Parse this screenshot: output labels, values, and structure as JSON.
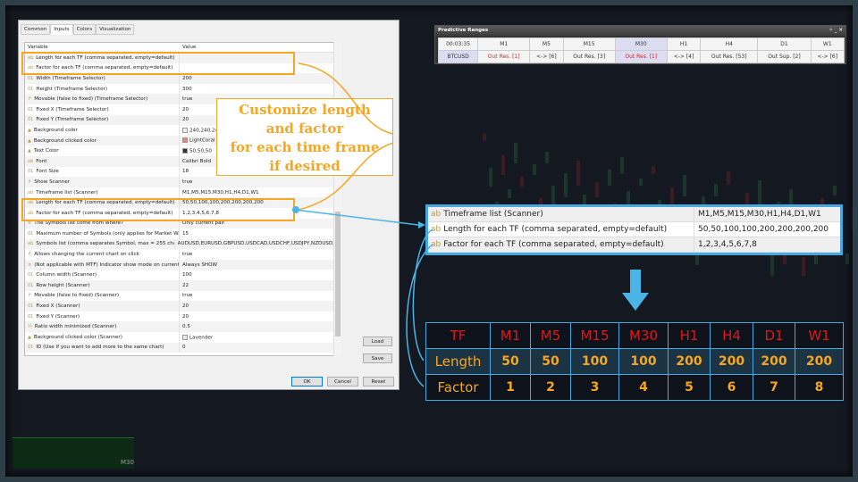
{
  "dialog": {
    "tabs": [
      "Common",
      "Inputs",
      "Colors",
      "Visualization"
    ],
    "active_tab": "Inputs",
    "columns": [
      "Variable",
      "Value"
    ],
    "rows": [
      {
        "icon": "ab",
        "name": "Length for each TF (comma separated, empty=default)",
        "value": ""
      },
      {
        "icon": "ab",
        "name": "Factor for each TF (comma separated, empty=default)",
        "value": ""
      },
      {
        "icon": "01",
        "name": "Width (Timeframe Selector)",
        "value": "200"
      },
      {
        "icon": "01",
        "name": "Height (Timeframe Selector)",
        "value": "300"
      },
      {
        "icon": "bool",
        "name": "Movable (false to fixed) (Timeframe Selector)",
        "value": "true"
      },
      {
        "icon": "01",
        "name": "Fixed X (Timeframe Selector)",
        "value": "20"
      },
      {
        "icon": "01",
        "name": "Fixed Y (Timeframe Selector)",
        "value": "20"
      },
      {
        "icon": "color",
        "name": "Background color",
        "value": "240,240,240",
        "swatch": "#f0f0f0"
      },
      {
        "icon": "color",
        "name": "Background clicked color",
        "value": "LightCoral",
        "swatch": "#f08080"
      },
      {
        "icon": "color",
        "name": "Text Color",
        "value": "50,50,50",
        "swatch": "#323232"
      },
      {
        "icon": "ab",
        "name": "Font",
        "value": "Calibri Bold"
      },
      {
        "icon": "01",
        "name": "Font Size",
        "value": "18"
      },
      {
        "icon": "bool",
        "name": "Show Scanner",
        "value": "true"
      },
      {
        "icon": "ab",
        "name": "Timeframe list (Scanner)",
        "value": "M1,M5,M15,M30,H1,H4,D1,W1"
      },
      {
        "icon": "ab",
        "name": "Length for each TF (comma separated, empty=default)",
        "value": "50,50,100,100,200,200,200,200"
      },
      {
        "icon": "ab",
        "name": "Factor for each TF (comma separated, empty=default)",
        "value": "1,2,3,4,5,6,7,8"
      },
      {
        "icon": "enum",
        "name": "The Symbols list come from where?",
        "value": "Only current pair"
      },
      {
        "icon": "01",
        "name": "Maximum number of Symbols (only applies for Market Watch)",
        "value": "15"
      },
      {
        "icon": "ab",
        "name": "Symbols list (comma separates Symbol, max = 255 characters)",
        "value": "AUDUSD,EURUSD,GBPUSD,USDCAD,USDCHF,USDJPY,NZDUSD,XA..."
      },
      {
        "icon": "bool",
        "name": "Allows changing the current chart on click",
        "value": "true"
      },
      {
        "icon": "enum",
        "name": "(Not applicable with MTF) Indicator show mode on current chart",
        "value": "Always SHOW"
      },
      {
        "icon": "01",
        "name": "Column width (Scanner)",
        "value": "100"
      },
      {
        "icon": "01",
        "name": "Row height (Scanner)",
        "value": "22"
      },
      {
        "icon": "bool",
        "name": "Movable (false to fixed) (Scanner)",
        "value": "true"
      },
      {
        "icon": "01",
        "name": "Fixed X (Scanner)",
        "value": "20"
      },
      {
        "icon": "01",
        "name": "Fixed Y (Scanner)",
        "value": "20"
      },
      {
        "icon": "frac",
        "name": "Ratio width minimized (Scanner)",
        "value": "0.5"
      },
      {
        "icon": "color",
        "name": "Background clicked color (Scanner)",
        "value": "Lavender",
        "swatch": "#e6e6fa"
      },
      {
        "icon": "01",
        "name": "ID (Use if you want to add more to the same chart)",
        "value": "0"
      }
    ],
    "buttons": {
      "load": "Load",
      "save": "Save",
      "ok": "OK",
      "cancel": "Cancel",
      "reset": "Reset"
    }
  },
  "callout": {
    "lines": [
      "Customize length",
      "and factor",
      "for each time frame",
      "if desired"
    ]
  },
  "predictive_ranges": {
    "title": "Predictive Ranges",
    "time": "00:03:35",
    "symbol": "BTCUSD",
    "timeframes": [
      "M1",
      "M5",
      "M15",
      "M30",
      "H1",
      "H4",
      "D1",
      "W1"
    ],
    "selected": "M30",
    "statuses": [
      {
        "text": "Out Res. [1]",
        "alert": true
      },
      {
        "text": "<-> [6]",
        "alert": false
      },
      {
        "text": "Out Res. [3]",
        "alert": false
      },
      {
        "text": "Out Res. [1]",
        "alert": true
      },
      {
        "text": "<-> [4]",
        "alert": false
      },
      {
        "text": "Out Res. [53]",
        "alert": false
      },
      {
        "text": "Out Sup. [2]",
        "alert": false
      },
      {
        "text": "<-> [6]",
        "alert": false
      }
    ]
  },
  "zoom_box": {
    "rows": [
      {
        "name": "Timeframe list (Scanner)",
        "value": "M1,M5,M15,M30,H1,H4,D1,W1"
      },
      {
        "name": "Length for each TF (comma separated, empty=default)",
        "value": "50,50,100,100,200,200,200,200"
      },
      {
        "name": "Factor for each TF (comma separated, empty=default)",
        "value": "1,2,3,4,5,6,7,8"
      }
    ]
  },
  "summary_table": {
    "header": [
      "TF",
      "M1",
      "M5",
      "M15",
      "M30",
      "H1",
      "H4",
      "D1",
      "W1"
    ],
    "length": [
      "Length",
      "50",
      "50",
      "100",
      "100",
      "200",
      "200",
      "200",
      "200"
    ],
    "factor": [
      "Factor",
      "1",
      "2",
      "3",
      "4",
      "5",
      "6",
      "7",
      "8"
    ]
  },
  "chart_labels": {
    "m30": "M30"
  },
  "colors": {
    "accent_orange": "#f5a623",
    "accent_blue": "#4aa8e0",
    "alert_red": "#e02020"
  }
}
